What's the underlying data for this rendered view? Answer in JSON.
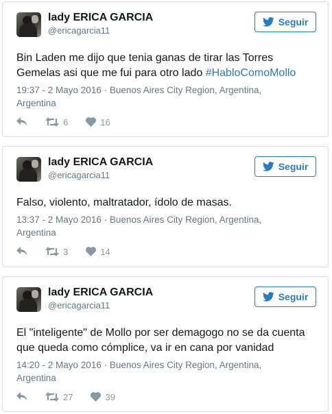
{
  "colors": {
    "accent": "#2b7bb9",
    "muted": "#657786",
    "icon": "#8899a6",
    "border": "#d8dee2"
  },
  "tweets": [
    {
      "name": "lady ERICA GARCIA",
      "handle": "@ericagarcia11",
      "follow_label": "Seguir",
      "text_line1": "Bin Laden me dijo que tenia ganas de tirar las Torres",
      "text_line2": "Gemelas asi que me fui para otro lado ",
      "hashtag": "#HabloComoMollo",
      "meta_line1": "19:37 - 2 Mayo 2016 · Buenos Aires City Region, Argentina,",
      "meta_line2": "Argentina",
      "retweets": "6",
      "likes": "16"
    },
    {
      "name": "lady ERICA GARCIA",
      "handle": "@ericagarcia11",
      "follow_label": "Seguir",
      "text_line1": "Falso, violento, maltratador, ídolo de masas.",
      "meta_line1": "13:37 - 2 Mayo 2016 · Buenos Aires City Region, Argentina,",
      "meta_line2": "Argentina",
      "retweets": "3",
      "likes": "14"
    },
    {
      "name": "lady ERICA GARCIA",
      "handle": "@ericagarcia11",
      "follow_label": "Seguir",
      "text_line1": "El \"inteligente\" de Mollo por ser demagogo no se da cuenta",
      "text_line2": "que queda como cómplice, va ir en cana por vanidad",
      "meta_line1": "14:20 - 2 Mayo 2016 · Buenos Aires City Region, Argentina,",
      "meta_line2": "Argentina",
      "retweets": "27",
      "likes": "39"
    }
  ]
}
